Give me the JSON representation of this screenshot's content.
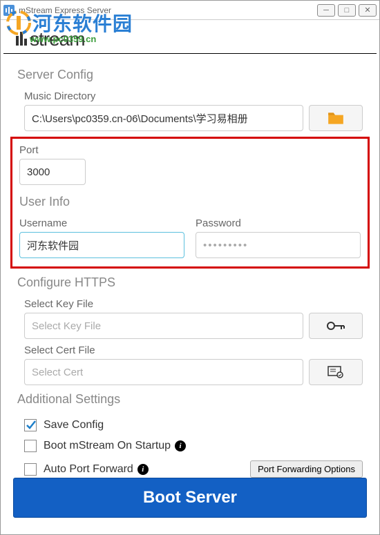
{
  "window": {
    "title": "mStream Express Server"
  },
  "watermark": {
    "line1": "河东软件园",
    "line2": "www.pc0359.cn"
  },
  "logo": "mstream",
  "server_config": {
    "title": "Server Config",
    "music_dir_label": "Music Directory",
    "music_dir_value": "C:\\Users\\pc0359.cn-06\\Documents\\学习易相册"
  },
  "port": {
    "label": "Port",
    "value": "3000"
  },
  "user_info": {
    "title": "User Info",
    "username_label": "Username",
    "username_value": "河东软件园",
    "password_label": "Password",
    "password_value": "•••••••••"
  },
  "https": {
    "title": "Configure HTTPS",
    "key_label": "Select Key File",
    "key_placeholder": "Select Key File",
    "cert_label": "Select Cert File",
    "cert_placeholder": "Select Cert"
  },
  "additional": {
    "title": "Additional Settings",
    "save_config": "Save Config",
    "boot_startup": "Boot mStream On Startup",
    "auto_port": "Auto Port Forward",
    "port_options_btn": "Port Forwarding Options"
  },
  "boot_button": "Boot Server"
}
